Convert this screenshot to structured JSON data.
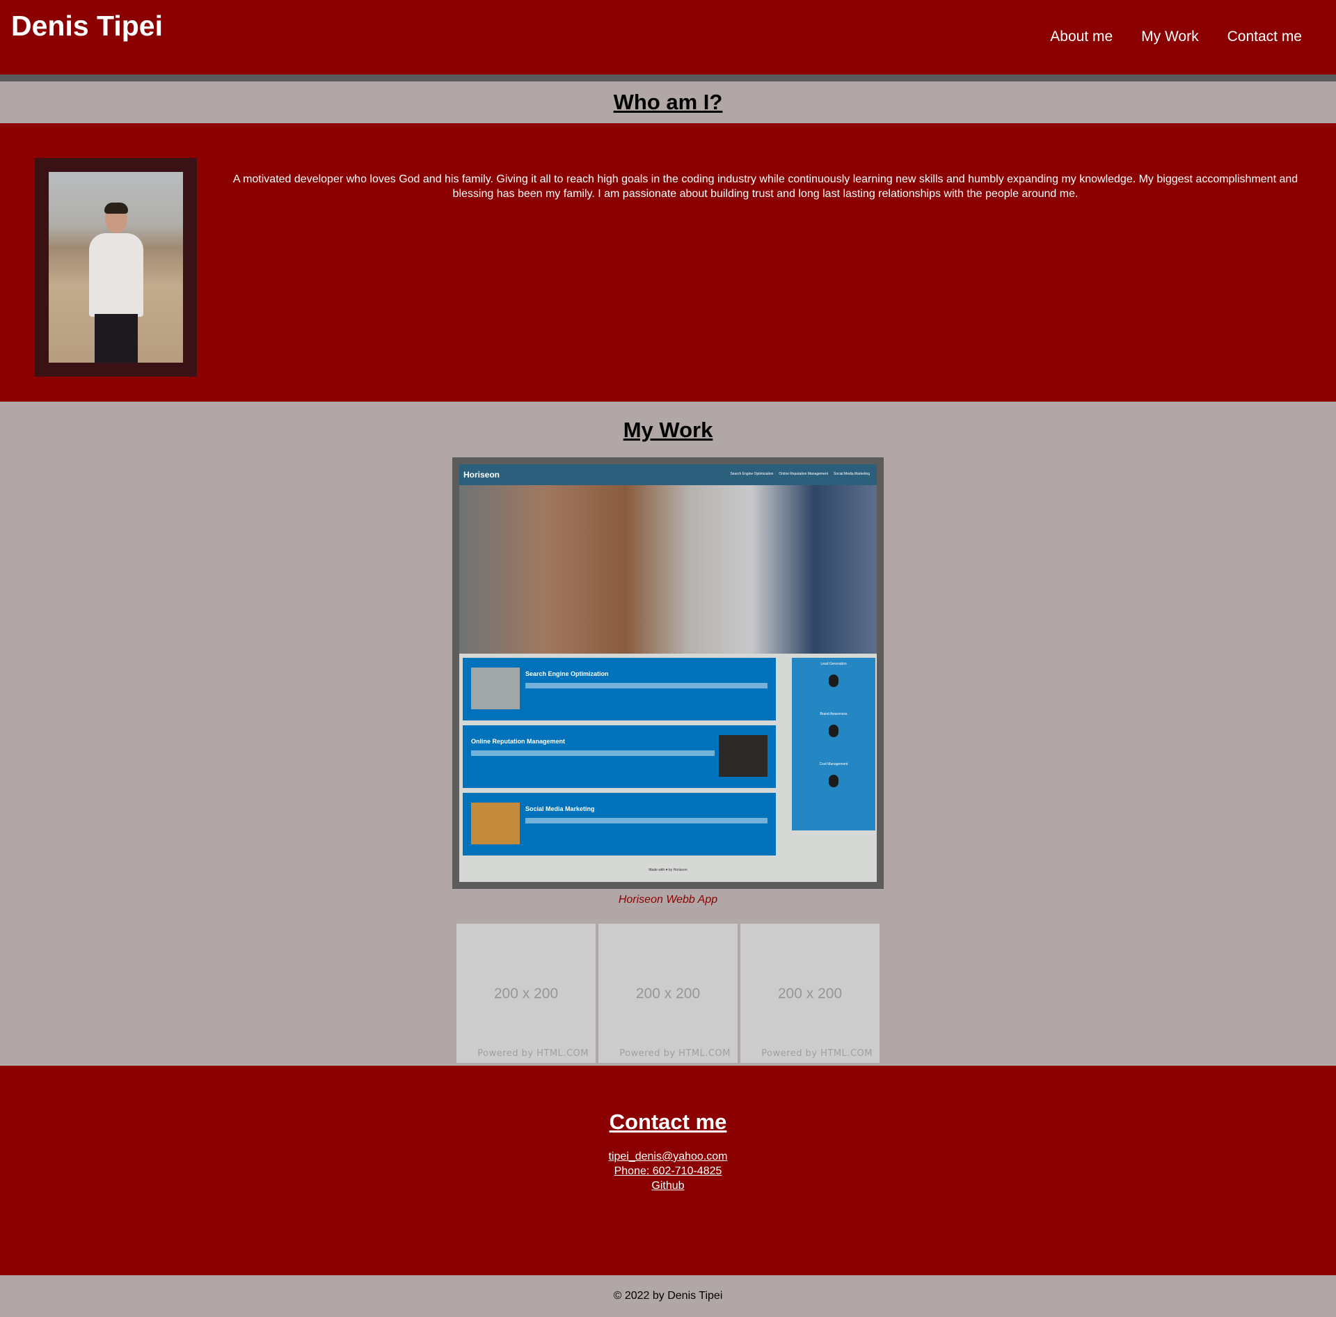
{
  "header": {
    "brand": "Denis Tipei",
    "nav": [
      "About me",
      "My Work",
      "Contact me"
    ]
  },
  "about": {
    "title": "Who am I?",
    "bio": "A motivated developer who loves God and his family. Giving it all to reach high goals in the coding industry while continuously learning new skills and humbly expanding my knowledge. My biggest accomplishment and blessing has been my family. I am passionate about building trust and long last lasting relationships with the people around me."
  },
  "work": {
    "title": "My Work",
    "featured_caption": "Horiseon Webb App",
    "mock": {
      "logo": "Horiseon",
      "links": [
        "Search Engine Optimization",
        "Online Reputation Management",
        "Social Media Marketing"
      ],
      "cards": [
        "Search Engine Optimization",
        "Online Reputation Management",
        "Social Media Marketing"
      ],
      "aside": [
        "Lead Generation",
        "Brand Awareness",
        "Cost Management"
      ],
      "footer": "Made with ♥ by Horiseon"
    },
    "placeholders": [
      {
        "size": "200 x 200",
        "powered": "Powered by HTML.COM"
      },
      {
        "size": "200 x 200",
        "powered": "Powered by HTML.COM"
      },
      {
        "size": "200 x 200",
        "powered": "Powered by HTML.COM"
      }
    ]
  },
  "contact": {
    "title": "Contact me",
    "email": "tipei_denis@yahoo.com",
    "phone": "Phone: 602-710-4825",
    "github": "Github"
  },
  "footer": {
    "copyright": "© 2022 by Denis Tipei"
  },
  "colors": {
    "primary": "#8b0000",
    "background": "#b1a7a6",
    "divider": "#5b5b5b"
  }
}
